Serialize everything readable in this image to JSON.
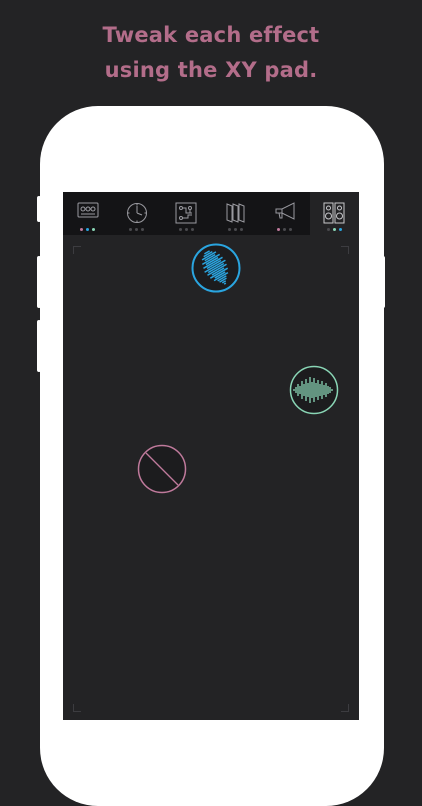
{
  "headline": {
    "line1": "Tweak each effect",
    "line2": "using the XY pad."
  },
  "colors": {
    "background": "#232325",
    "headline": "#b36d8a",
    "phone": "#ffffff",
    "toolbar": "#141416",
    "blue": "#2aa5e0",
    "green": "#8ad6b6",
    "pink": "#c07a9c"
  },
  "toolbar": {
    "tabs": [
      {
        "icon": "tape-icon",
        "active": false,
        "dots": [
          "#c07a9c",
          "#2aa5e0",
          "#8ad6b6"
        ]
      },
      {
        "icon": "clock-icon",
        "active": false,
        "dots": [
          "#4a4a4e",
          "#4a4a4e",
          "#4a4a4e"
        ]
      },
      {
        "icon": "circuit-icon",
        "active": false,
        "dots": [
          "#4a4a4e",
          "#4a4a4e",
          "#4a4a4e"
        ]
      },
      {
        "icon": "panels-icon",
        "active": false,
        "dots": [
          "#4a4a4e",
          "#4a4a4e",
          "#4a4a4e"
        ]
      },
      {
        "icon": "megaphone-icon",
        "active": false,
        "dots": [
          "#c07a9c",
          "#4a4a4e",
          "#4a4a4e"
        ]
      },
      {
        "icon": "speakers-icon",
        "active": true,
        "dots": [
          "#4a4a4e",
          "#8ad6b6",
          "#2aa5e0"
        ]
      }
    ]
  },
  "xy_pad": {
    "knobs": [
      {
        "name": "blue-waveform-knob",
        "color": "#2aa5e0"
      },
      {
        "name": "green-waveform-knob",
        "color": "#8ad6b6"
      },
      {
        "name": "pink-disabled-knob",
        "color": "#c07a9c"
      }
    ]
  }
}
